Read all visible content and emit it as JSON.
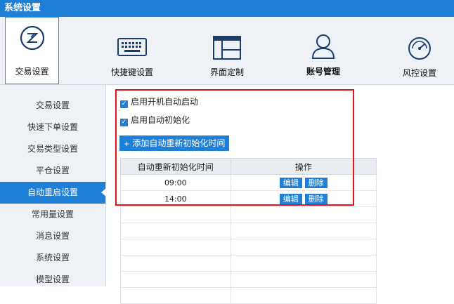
{
  "window": {
    "title": "系统设置"
  },
  "toolbar": {
    "items": [
      {
        "label": "交易设置",
        "icon": "trade-z-icon",
        "active": true
      },
      {
        "label": "快捷键设置",
        "icon": "keyboard-icon",
        "active": false
      },
      {
        "label": "界面定制",
        "icon": "layout-icon",
        "active": false
      },
      {
        "label": "账号管理",
        "icon": "user-icon",
        "active": false
      },
      {
        "label": "风控设置",
        "icon": "gauge-icon",
        "active": false
      }
    ]
  },
  "sidebar": {
    "items": [
      {
        "label": "交易设置"
      },
      {
        "label": "快速下单设置"
      },
      {
        "label": "交易类型设置"
      },
      {
        "label": "平仓设置"
      },
      {
        "label": "自动重启设置",
        "active": true
      },
      {
        "label": "常用量设置"
      },
      {
        "label": "消息设置"
      },
      {
        "label": "系统设置"
      },
      {
        "label": "模型设置"
      }
    ]
  },
  "main": {
    "checkbox_startup": {
      "label": "启用开机自动启动",
      "checked": true
    },
    "checkbox_auto_init": {
      "label": "启用自动初始化",
      "checked": true
    },
    "add_button_label": "添加自动重新初始化时间",
    "add_button_icon": "+",
    "table": {
      "columns": [
        "自动重新初始化时间",
        "操作"
      ],
      "rows": [
        {
          "time": "09:00",
          "edit": "编辑",
          "delete": "删除"
        },
        {
          "time": "14:00",
          "edit": "编辑",
          "delete": "删除"
        }
      ]
    }
  },
  "colors": {
    "accent": "#1e7fd6",
    "highlight": "#e1141c",
    "toolbar_bg": "#eef2f7"
  }
}
